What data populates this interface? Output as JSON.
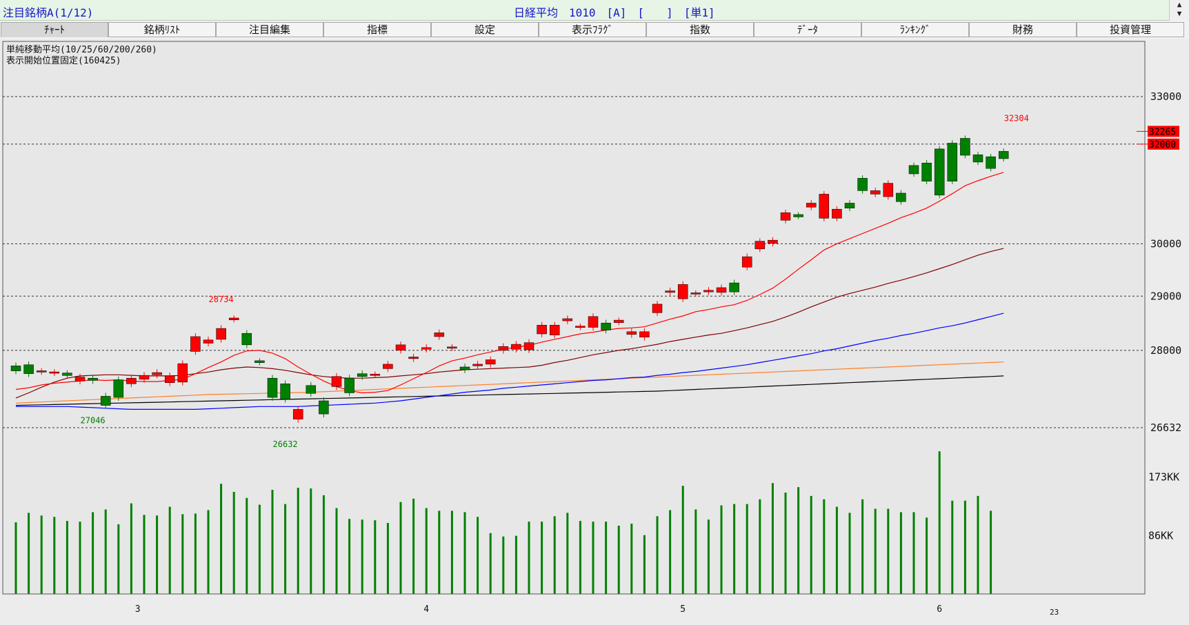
{
  "window": {
    "title_left": "注目銘柄A(1/12)",
    "title_center": "日経平均　1010　[A]　[　　]　[単1]",
    "scroll_up": "▲",
    "scroll_down": "▼"
  },
  "tabs": [
    {
      "label": "ﾁｬｰﾄ",
      "active": true
    },
    {
      "label": "銘柄ﾘｽﾄ"
    },
    {
      "label": "注目編集"
    },
    {
      "label": "指標"
    },
    {
      "label": "設定"
    },
    {
      "label": "表示ﾌﾗｸﾞ"
    },
    {
      "label": "指数"
    },
    {
      "label": "ﾃﾞｰﾀ"
    },
    {
      "label": "ﾗﾝｷﾝｸﾞ"
    },
    {
      "label": "財務"
    },
    {
      "label": "投資管理"
    }
  ],
  "chart_data": {
    "type": "candlestick",
    "indicator_label": "単純移動平均(10/25/60/200/260)",
    "display_label": "表示開始位置固定(160425)",
    "price_axis": {
      "min": 25900,
      "max": 33900,
      "ticks": [
        33000,
        29000,
        28000,
        30000,
        26632
      ],
      "tick_labels": [
        "33000",
        "29000",
        "28000",
        "30000",
        "26632"
      ],
      "grid_values": [
        33000,
        32000,
        30000,
        29000,
        28000,
        26632
      ]
    },
    "volume_axis": {
      "labels": [
        "173KK",
        "86KK"
      ],
      "label_values": [
        173,
        86
      ]
    },
    "x_labels": [
      "3",
      "4",
      "5",
      "6"
    ],
    "x_label_index": [
      9.5,
      32,
      52,
      72
    ],
    "year_label": "23",
    "annotations": [
      {
        "text": "32304",
        "type": "high",
        "index": 78,
        "value": 32304,
        "color": "#ff0000"
      },
      {
        "text": "28734",
        "type": "high",
        "index": 16,
        "value": 28734,
        "color": "#ff0000"
      },
      {
        "text": "27046",
        "type": "low",
        "index": 6,
        "value": 27046,
        "color": "#008000"
      },
      {
        "text": "26632",
        "type": "low",
        "index": 21,
        "value": 26632,
        "color": "#008000"
      }
    ],
    "price_markers": [
      {
        "text": "32265",
        "value": 32265
      },
      {
        "text": "32000",
        "value": 32000
      }
    ],
    "candles": {
      "open": [
        27720,
        27740,
        27620,
        27600,
        27580,
        27450,
        27500,
        27180,
        27470,
        27400,
        27480,
        27560,
        27420,
        27430,
        27980,
        28130,
        28200,
        28570,
        28310,
        27800,
        27500,
        27400,
        26780,
        27370,
        27100,
        27350,
        27500,
        27580,
        27560,
        27670,
        28000,
        27850,
        28020,
        28250,
        28050,
        27700,
        27720,
        27750,
        28000,
        28020,
        28010,
        28300,
        28280,
        28540,
        28430,
        28420,
        28500,
        28520,
        28290,
        28240,
        28690,
        29070,
        28950,
        29050,
        29080,
        29070,
        29250,
        29550,
        29900,
        30010,
        30460,
        30560,
        30720,
        30500,
        30500,
        30800,
        31300,
        30980,
        30930,
        31000,
        31560,
        31610,
        31900,
        32020,
        32120,
        31780,
        31740,
        31850
      ],
      "close": [
        27630,
        27580,
        27620,
        27600,
        27560,
        27520,
        27460,
        27020,
        27160,
        27500,
        27550,
        27600,
        27540,
        27760,
        28250,
        28190,
        28400,
        28580,
        28100,
        27790,
        27160,
        27130,
        26950,
        27230,
        26870,
        27530,
        27240,
        27530,
        27560,
        27750,
        28100,
        27880,
        28050,
        28320,
        28050,
        27650,
        27750,
        27830,
        28070,
        28110,
        28140,
        28460,
        28460,
        28580,
        28430,
        28620,
        28370,
        28540,
        28340,
        28340,
        28850,
        29100,
        29220,
        29050,
        29110,
        29160,
        29080,
        29750,
        30050,
        30070,
        30610,
        30540,
        30800,
        30980,
        30680,
        30700,
        31050,
        31050,
        31200,
        30830,
        31390,
        31240,
        30960,
        31240,
        31770,
        31630,
        31500,
        31700
      ]
    },
    "ma10": [
      27300,
      27330,
      27380,
      27410,
      27430,
      27450,
      27470,
      27460,
      27470,
      27450,
      27440,
      27440,
      27460,
      27480,
      27580,
      27690,
      27790,
      27910,
      27990,
      28000,
      27950,
      27850,
      27700,
      27570,
      27450,
      27350,
      27280,
      27240,
      27250,
      27280,
      27380,
      27490,
      27600,
      27720,
      27810,
      27860,
      27920,
      27970,
      28020,
      28060,
      28090,
      28150,
      28200,
      28250,
      28300,
      28330,
      28370,
      28400,
      28410,
      28430,
      28500,
      28570,
      28630,
      28710,
      28750,
      28800,
      28840,
      28920,
      29030,
      29150,
      29320,
      29510,
      29690,
      29880,
      30000,
      30100,
      30200,
      30300,
      30400,
      30510,
      30600,
      30700,
      30840,
      30990,
      31150,
      31250,
      31340,
      31420
    ],
    "ma25": [
      27150,
      27240,
      27340,
      27430,
      27500,
      27540,
      27550,
      27560,
      27560,
      27550,
      27540,
      27540,
      27540,
      27550,
      27580,
      27610,
      27650,
      27680,
      27700,
      27690,
      27670,
      27640,
      27600,
      27560,
      27530,
      27510,
      27500,
      27500,
      27510,
      27520,
      27540,
      27560,
      27580,
      27610,
      27630,
      27650,
      27660,
      27670,
      27680,
      27690,
      27700,
      27730,
      27780,
      27820,
      27870,
      27920,
      27960,
      28000,
      28030,
      28070,
      28110,
      28160,
      28200,
      28240,
      28280,
      28310,
      28360,
      28410,
      28470,
      28530,
      28610,
      28700,
      28800,
      28890,
      28980,
      29050,
      29110,
      29170,
      29240,
      29300,
      29370,
      29440,
      29520,
      29600,
      29690,
      29780,
      29850,
      29910
    ],
    "ma60": [
      27000,
      27000,
      27000,
      27000,
      27000,
      26990,
      26980,
      26970,
      26960,
      26950,
      26950,
      26950,
      26950,
      26950,
      26950,
      26960,
      26970,
      26980,
      26990,
      27000,
      27000,
      27000,
      27000,
      27010,
      27020,
      27030,
      27040,
      27050,
      27060,
      27080,
      27100,
      27130,
      27160,
      27190,
      27220,
      27250,
      27270,
      27290,
      27320,
      27340,
      27360,
      27380,
      27400,
      27420,
      27440,
      27460,
      27470,
      27490,
      27510,
      27520,
      27550,
      27570,
      27600,
      27620,
      27650,
      27680,
      27710,
      27740,
      27780,
      27820,
      27860,
      27900,
      27940,
      27990,
      28030,
      28080,
      28130,
      28180,
      28220,
      28270,
      28310,
      28360,
      28410,
      28450,
      28500,
      28560,
      28620,
      28680
    ],
    "ma200": [
      27060,
      27070,
      27080,
      27090,
      27100,
      27110,
      27120,
      27130,
      27140,
      27150,
      27160,
      27170,
      27180,
      27190,
      27200,
      27210,
      27215,
      27220,
      27225,
      27230,
      27235,
      27240,
      27245,
      27250,
      27260,
      27270,
      27280,
      27290,
      27300,
      27310,
      27320,
      27330,
      27340,
      27350,
      27360,
      27370,
      27380,
      27390,
      27400,
      27410,
      27420,
      27430,
      27440,
      27450,
      27460,
      27470,
      27480,
      27490,
      27500,
      27510,
      27520,
      27530,
      27540,
      27550,
      27560,
      27570,
      27580,
      27590,
      27600,
      27610,
      27620,
      27630,
      27640,
      27650,
      27660,
      27670,
      27680,
      27690,
      27700,
      27710,
      27720,
      27730,
      27740,
      27750,
      27760,
      27770,
      27780,
      27790
    ],
    "ma260": [
      27020,
      27025,
      27030,
      27035,
      27040,
      27045,
      27050,
      27055,
      27060,
      27065,
      27070,
      27075,
      27080,
      27085,
      27090,
      27095,
      27100,
      27105,
      27110,
      27115,
      27120,
      27125,
      27130,
      27135,
      27140,
      27145,
      27150,
      27155,
      27160,
      27165,
      27170,
      27175,
      27180,
      27185,
      27190,
      27195,
      27200,
      27205,
      27210,
      27215,
      27220,
      27225,
      27230,
      27235,
      27240,
      27245,
      27250,
      27255,
      27260,
      27265,
      27270,
      27280,
      27290,
      27300,
      27310,
      27320,
      27330,
      27340,
      27350,
      27360,
      27370,
      27380,
      27390,
      27400,
      27410,
      27420,
      27430,
      27440,
      27450,
      27460,
      27470,
      27480,
      27490,
      27500,
      27510,
      27520,
      27530,
      27540
    ],
    "volume": [
      106,
      120,
      116,
      114,
      108,
      107,
      121,
      125,
      103,
      134,
      117,
      116,
      129,
      118,
      119,
      124,
      163,
      151,
      142,
      132,
      154,
      133,
      157,
      156,
      146,
      127,
      111,
      110,
      109,
      105,
      136,
      141,
      127,
      123,
      123,
      121,
      114,
      90,
      85,
      86,
      107,
      107,
      115,
      120,
      108,
      107,
      107,
      101,
      104,
      87,
      115,
      124,
      160,
      125,
      110,
      131,
      133,
      133,
      140,
      164,
      150,
      158,
      145,
      140,
      129,
      120,
      140,
      126,
      126,
      121,
      121,
      113,
      211,
      138,
      138,
      145,
      123
    ],
    "ma_colors": {
      "ma10": "#ff0000",
      "ma25": "#800000",
      "ma60": "#0000ff",
      "ma200": "#ff7f27",
      "ma260": "#000000"
    },
    "candle_colors": {
      "up": "#ff0000",
      "down": "#008000"
    }
  }
}
